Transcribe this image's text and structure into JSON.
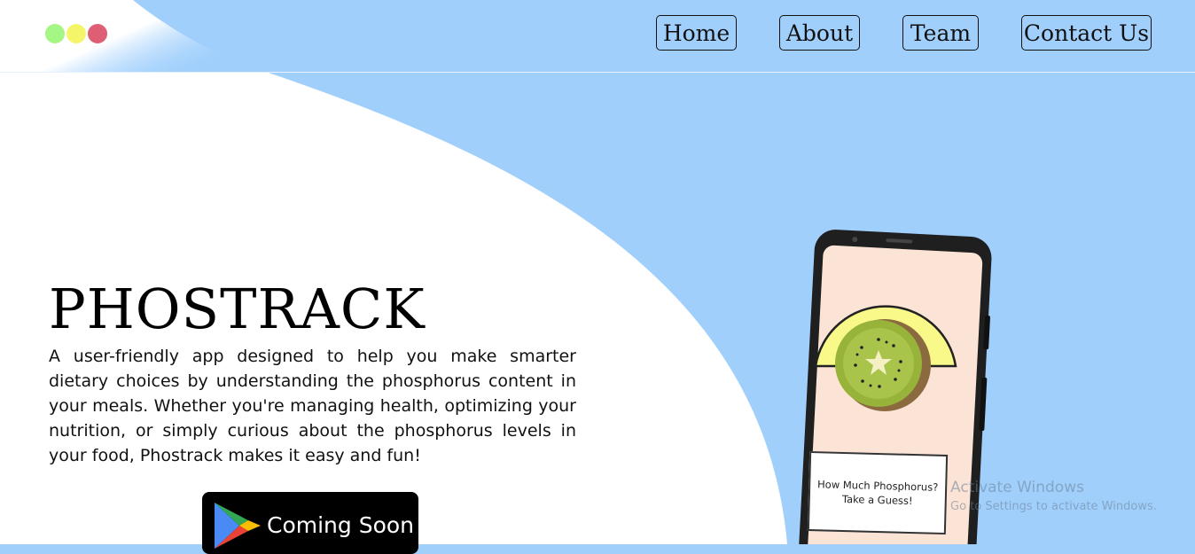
{
  "colors": {
    "background": "#a0cffc",
    "hero_white": "#ffffff",
    "dot_green": "#a4f784",
    "dot_yellow": "#f5f56a",
    "dot_red": "#de5f74",
    "phone_screen": "#fbe3d6",
    "kiwi_yellow": "#f8f989"
  },
  "header": {
    "nav": [
      {
        "label": "Home"
      },
      {
        "label": "About"
      },
      {
        "label": "Team"
      },
      {
        "label": "Contact Us"
      }
    ]
  },
  "hero": {
    "title": "PHOSTRACK",
    "description": "A user-friendly app designed to help you make smarter dietary choices by understanding the phosphorus content in your meals. Whether you're managing health, optimizing your nutrition, or simply curious about the phosphorus levels in your food, Phostrack makes it easy and fun!",
    "store_button": {
      "label": "Coming Soon",
      "icon": "google-play-icon"
    }
  },
  "phone": {
    "card_line1": "How Much Phosphorus?",
    "card_line2": "Take a Guess!",
    "image": "kiwi-icon"
  },
  "watermark": {
    "title": "Activate Windows",
    "subtitle": "Go to Settings to activate Windows."
  }
}
